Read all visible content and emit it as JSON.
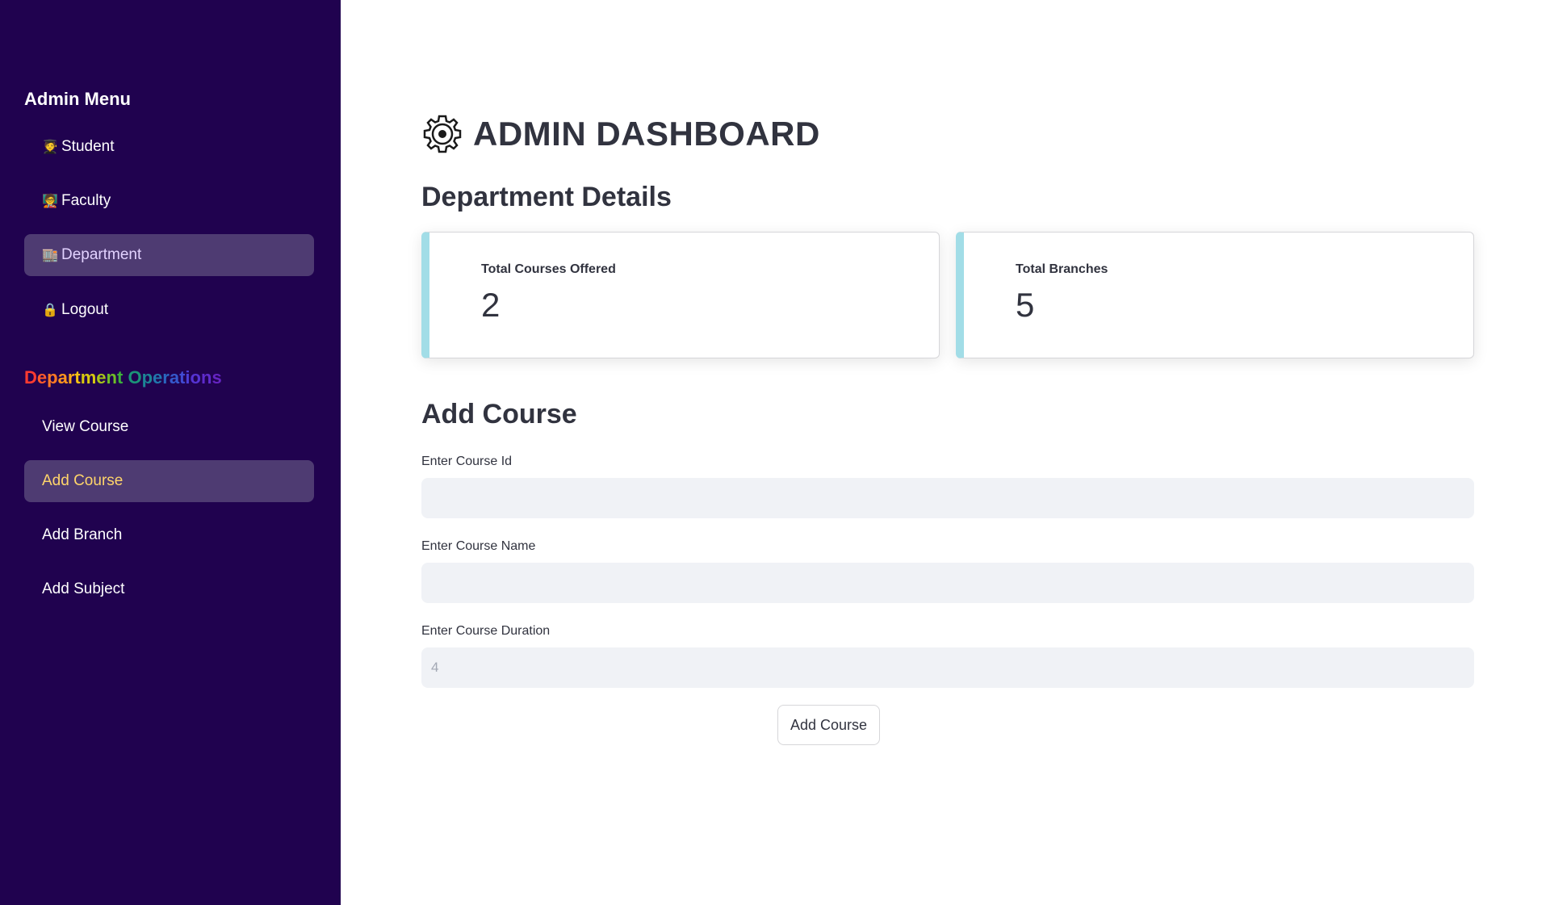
{
  "sidebar": {
    "admin_menu_title": "Admin Menu",
    "menu_items": [
      {
        "icon": "🧑‍🎓",
        "label": "Student"
      },
      {
        "icon": "🧑‍🏫",
        "label": "Faculty"
      },
      {
        "icon": "🏬",
        "label": "Department"
      },
      {
        "icon": "🔒",
        "label": "Logout"
      }
    ],
    "operations_title": "Department Operations",
    "operation_items": [
      {
        "label": "View Course"
      },
      {
        "label": "Add Course"
      },
      {
        "label": "Add Branch"
      },
      {
        "label": "Add Subject"
      }
    ],
    "colors": {
      "background": "#20024f",
      "active_item": "#4e3b72",
      "active_text": "#ffd56a"
    }
  },
  "main": {
    "title": "ADMIN DASHBOARD",
    "title_icon": "gear-icon",
    "department_details_heading": "Department Details",
    "metrics": [
      {
        "label": "Total Courses Offered",
        "value": "2"
      },
      {
        "label": "Total Branches",
        "value": "5"
      }
    ],
    "add_course_heading": "Add Course",
    "form": {
      "course_id_label": "Enter Course Id",
      "course_id_value": "",
      "course_name_label": "Enter Course Name",
      "course_name_value": "",
      "course_duration_label": "Enter Course Duration",
      "course_duration_placeholder": "4"
    },
    "submit_label": "Add Course",
    "colors": {
      "metric_accent": "#a2dde7",
      "input_bg": "#f0f2f6"
    }
  }
}
